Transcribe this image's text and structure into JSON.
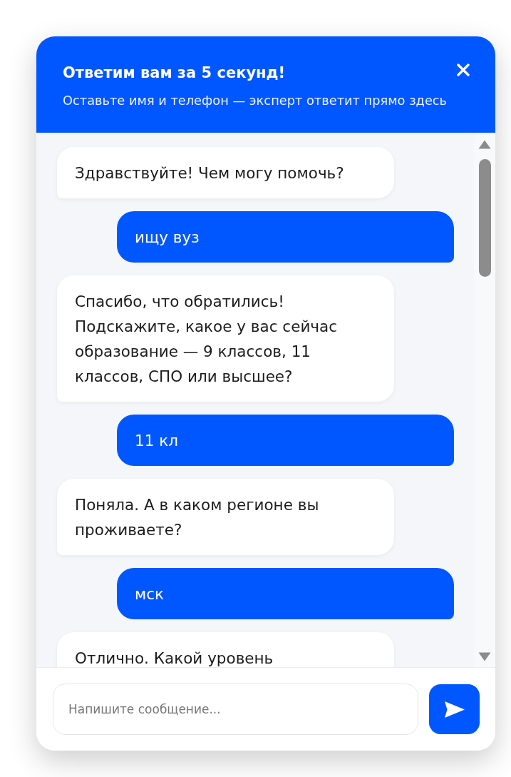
{
  "header": {
    "title": "Ответим вам за 5 секунд!",
    "subtitle": "Оставьте имя и телефон — эксперт ответит прямо здесь"
  },
  "messages": [
    {
      "kind": "bot",
      "text": "Здравствуйте! Чем могу помочь?"
    },
    {
      "kind": "user",
      "text": "ищу вуз"
    },
    {
      "kind": "bot",
      "text": "Спасибо, что обратились! Подскажите, какое у вас сейчас образование — 9 классов, 11 классов, СПО или высшее?"
    },
    {
      "kind": "user",
      "text": "11 кл"
    },
    {
      "kind": "bot",
      "text": "Поняла. А в каком регионе вы проживаете?"
    },
    {
      "kind": "user",
      "text": "мск"
    },
    {
      "kind": "bot",
      "text": "Отлично. Какой уровень"
    }
  ],
  "composer": {
    "placeholder": "Напишите сообщение..."
  }
}
